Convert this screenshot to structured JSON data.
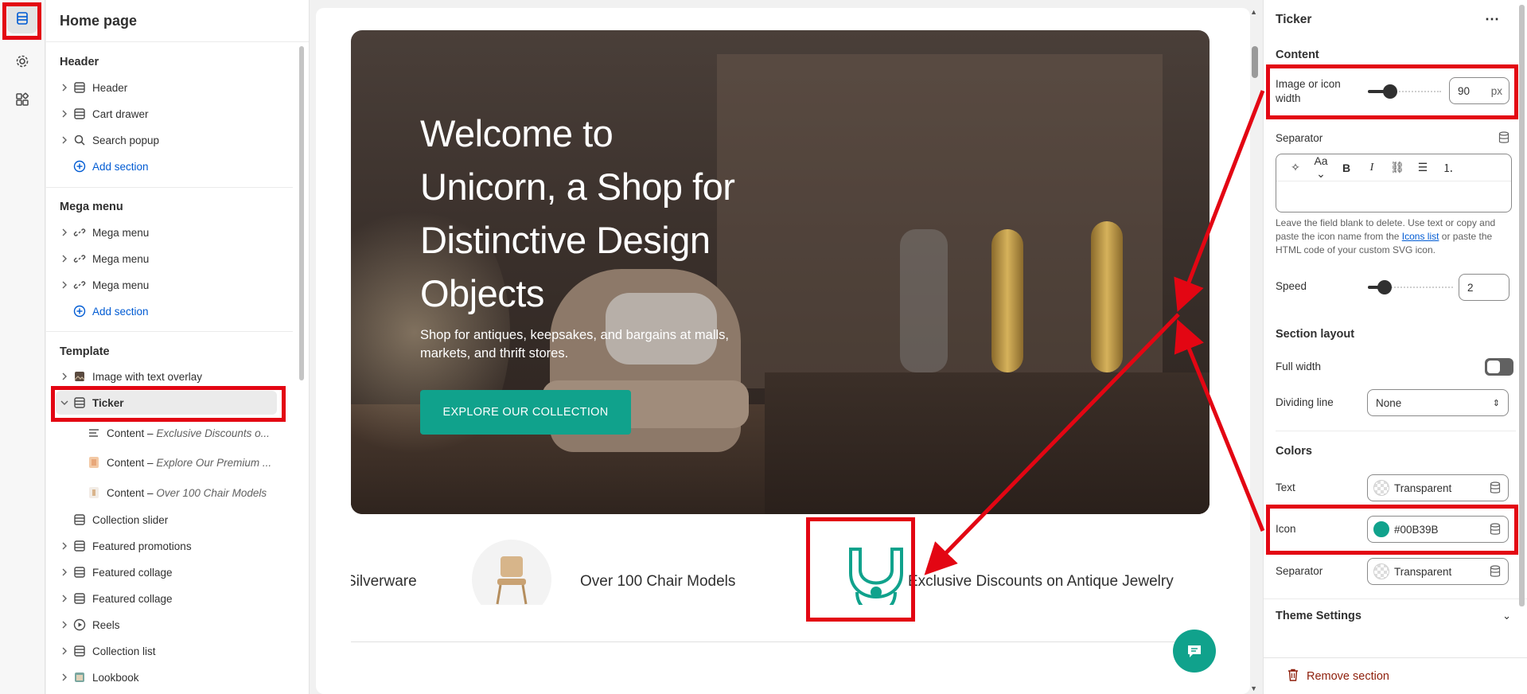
{
  "left_panel": {
    "title": "Home page",
    "groups": {
      "header": {
        "title": "Header",
        "items": [
          {
            "label": "Header",
            "icon": "layout-icon"
          },
          {
            "label": "Cart drawer",
            "icon": "layout-icon"
          },
          {
            "label": "Search popup",
            "icon": "search-icon"
          }
        ],
        "add_label": "Add section"
      },
      "mega": {
        "title": "Mega menu",
        "items": [
          {
            "label": "Mega menu",
            "icon": "link-icon"
          },
          {
            "label": "Mega menu",
            "icon": "link-icon"
          },
          {
            "label": "Mega menu",
            "icon": "link-icon"
          }
        ],
        "add_label": "Add section"
      },
      "template": {
        "title": "Template",
        "items": [
          {
            "label": "Image with text overlay",
            "icon": "image-icon"
          },
          {
            "label": "Ticker",
            "icon": "layout-icon"
          },
          {
            "label": "Content",
            "detail": "Exclusive Discounts o...",
            "icon": "text-icon"
          },
          {
            "label": "Content",
            "detail": "Explore Our Premium ...",
            "icon": "thumbnail-icon"
          },
          {
            "label": "Content",
            "detail": "Over 100 Chair Models",
            "icon": "thumbnail-icon"
          },
          {
            "label": "Collection slider",
            "icon": "layout-icon"
          },
          {
            "label": "Featured promotions",
            "icon": "layout-icon"
          },
          {
            "label": "Featured collage",
            "icon": "layout-icon"
          },
          {
            "label": "Featured collage",
            "icon": "layout-icon"
          },
          {
            "label": "Reels",
            "icon": "play-icon"
          },
          {
            "label": "Collection list",
            "icon": "layout-icon"
          },
          {
            "label": "Lookbook",
            "icon": "image-icon"
          }
        ],
        "dash": " – "
      }
    }
  },
  "preview": {
    "hero": {
      "heading": "Welcome to Unicorn, a Shop for Distinctive Design Objects",
      "subtext": "Shop for antiques, keepsakes, and bargains at malls, markets, and thrift stores.",
      "cta": "EXPLORE OUR COLLECTION"
    },
    "ticker": {
      "item_1": "Silverware",
      "item_2": "Over 100 Chair Models",
      "item_3": "Exclusive Discounts on Antique Jewelry",
      "icon_color": "#10a28c"
    }
  },
  "right_panel": {
    "title": "Ticker",
    "content_heading": "Content",
    "image_width": {
      "label": "Image or icon width",
      "value": "90",
      "unit": "px",
      "level": 0.3
    },
    "separator": {
      "label": "Separator",
      "toolbar": [
        "sparkle-icon",
        "text-size-icon",
        "bold-icon",
        "italic-icon",
        "link-icon",
        "bullet-list-icon",
        "number-list-icon"
      ],
      "aa": "Aa",
      "b": "B",
      "i": "I"
    },
    "help_text_1": "Leave the field blank to delete. Use text or copy and paste the icon name from the ",
    "help_link": "Icons list",
    "help_text_2": " or paste the HTML code of your custom SVG icon.",
    "speed": {
      "label": "Speed",
      "value": "2",
      "level": 0.2
    },
    "layout_heading": "Section layout",
    "full_width": {
      "label": "Full width",
      "on": false
    },
    "dividing_line": {
      "label": "Dividing line",
      "value": "None"
    },
    "colors_heading": "Colors",
    "colors": {
      "text": {
        "label": "Text",
        "value": "Transparent"
      },
      "icon": {
        "label": "Icon",
        "value": "#00B39B",
        "swatch": "#10a28c"
      },
      "separator": {
        "label": "Separator",
        "value": "Transparent"
      }
    },
    "theme_settings": "Theme Settings",
    "remove": "Remove section"
  },
  "colors": {
    "accent": "#10a28c",
    "annotation": "#e30613",
    "link": "#005bd3",
    "danger": "#8e1f0b"
  }
}
